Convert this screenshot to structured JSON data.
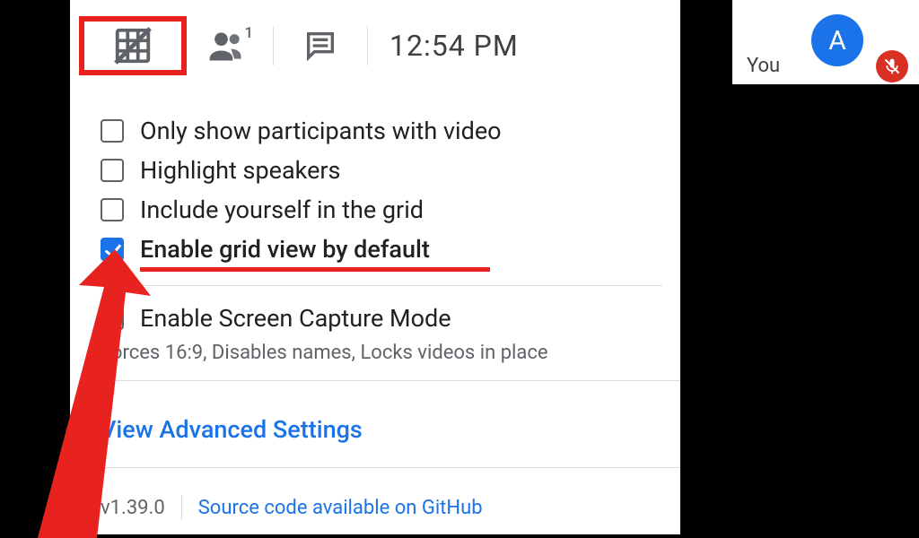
{
  "toolbar": {
    "clock": "12:54 PM",
    "participants_count": "1"
  },
  "options": {
    "only_video": {
      "label": "Only show participants with video",
      "checked": false
    },
    "highlight": {
      "label": "Highlight speakers",
      "checked": false
    },
    "include_self": {
      "label": "Include yourself in the grid",
      "checked": false
    },
    "enable_default": {
      "label": "Enable grid view by default",
      "checked": true
    },
    "screen_capture": {
      "label": "Enable Screen Capture Mode",
      "checked": false,
      "description": "Forces 16:9, Disables names, Locks videos in place"
    }
  },
  "links": {
    "advanced": "View Advanced Settings",
    "source": "Source code available on GitHub"
  },
  "footer": {
    "version": "v1.39.0"
  },
  "selfview": {
    "label": "You",
    "avatar_initial": "A"
  }
}
